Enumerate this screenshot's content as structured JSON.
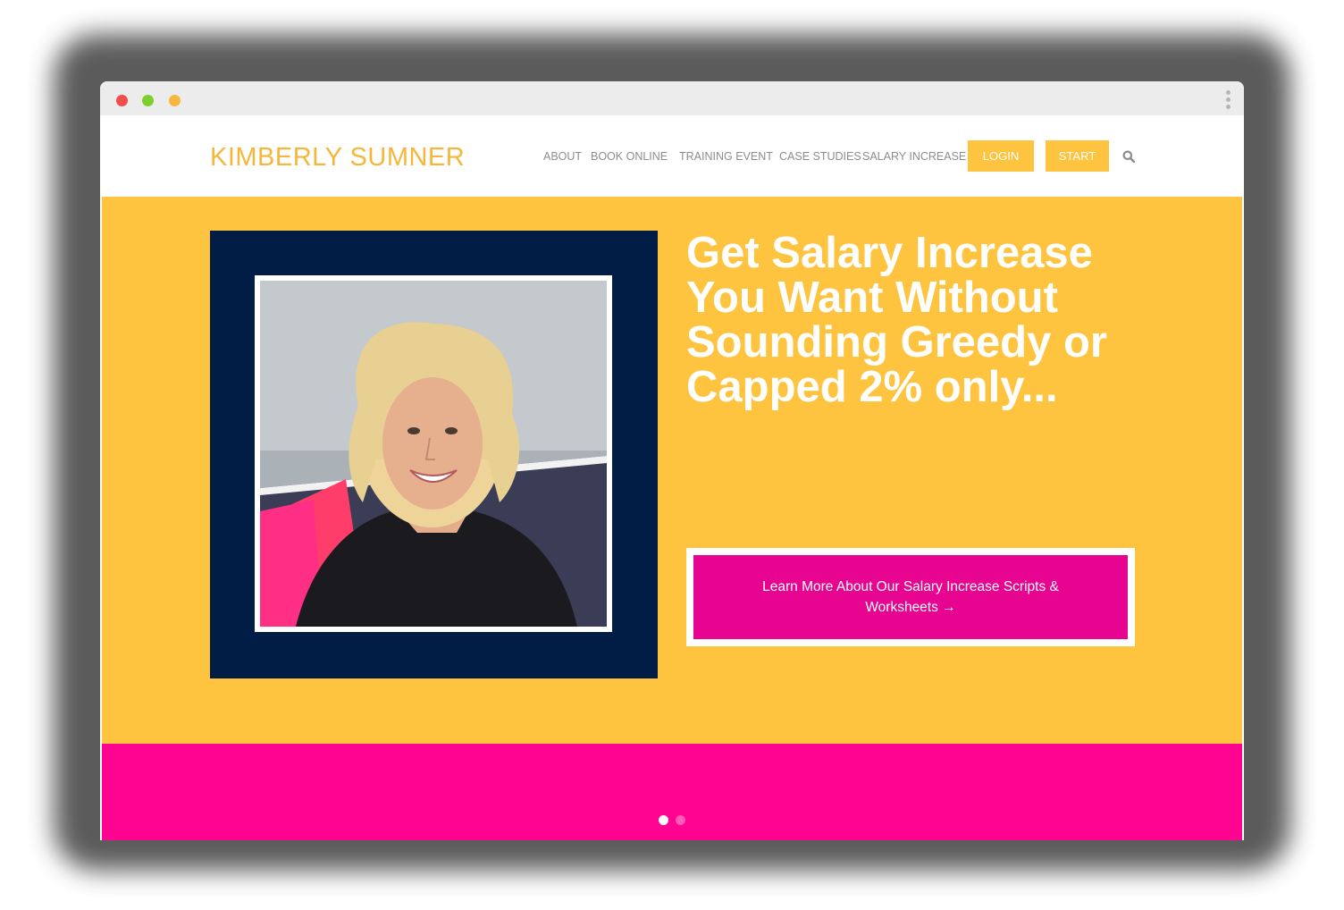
{
  "site": {
    "logo": "KIMBERLY SUMNER",
    "nav": [
      {
        "label": "ABOUT"
      },
      {
        "label": "BOOK ONLINE"
      },
      {
        "label": "TRAINING EVENT"
      },
      {
        "label": "CASE STUDIES"
      },
      {
        "label": "SALARY INCREASE"
      }
    ],
    "buttons": {
      "login": "LOGIN",
      "start": "START"
    },
    "search_icon": "search-icon"
  },
  "hero": {
    "headline": "Get Salary Increase You Want Without Sounding Greedy or Capped 2% only...",
    "cta": "Learn More About Our Salary Increase Scripts & Worksheets →",
    "photo_alt": "smiling woman with curly blonde hair"
  },
  "slider": {
    "dots": 2,
    "active": 1
  },
  "colors": {
    "accent_yellow": "#ffc43f",
    "logo_yellow": "#f5b73b",
    "navy": "#021d45",
    "magenta": "#e60490",
    "pink": "#ff0490"
  }
}
